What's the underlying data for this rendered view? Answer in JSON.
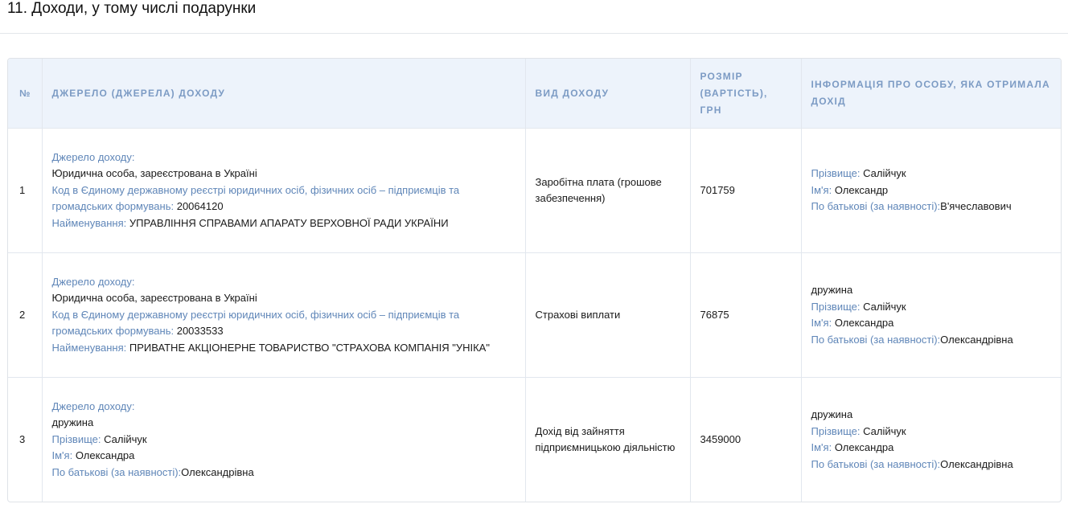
{
  "section": {
    "title": "11. Доходи, у тому числі подарунки"
  },
  "table": {
    "headers": {
      "number": "№",
      "source": "Джерело (джерела) доходу",
      "type": "Вид доходу",
      "amount": "Розмір (вартість), грн",
      "person": "Інформація про особу, яка отримала дохід"
    },
    "rows": [
      {
        "number": "1",
        "source_label": "Джерело доходу:",
        "source_kind": "Юридична особа, зареєстрована в Україні",
        "code_label": "Код в Єдиному державному реєстрі юридичних осіб, фізичних осіб – підприємців та громадських формувань:",
        "code_value": "20064120",
        "name_label": "Найменування:",
        "name_value": "УПРАВЛІННЯ СПРАВАМИ АПАРАТУ ВЕРХОВНОЇ РАДИ УКРАЇНИ",
        "income_type": "Заробітна плата (грошове забезпечення)",
        "amount": "701759",
        "person": {
          "surname_label": "Прізвище:",
          "surname": "Салійчук",
          "name_label": "Ім'я:",
          "name": "Олександр",
          "patronymic_label": "По батькові (за наявності):",
          "patronymic": "В'ячеславович"
        }
      },
      {
        "number": "2",
        "source_label": "Джерело доходу:",
        "source_kind": "Юридична особа, зареєстрована в Україні",
        "code_label": "Код в Єдиному державному реєстрі юридичних осіб, фізичних осіб – підприємців та громадських формувань:",
        "code_value": "20033533",
        "name_label": "Найменування:",
        "name_value": "ПРИВАТНЕ АКЦІОНЕРНЕ ТОВАРИСТВО \"СТРАХОВА КОМПАНІЯ \"УНІКА\"",
        "income_type": "Страхові виплати",
        "amount": "76875",
        "person": {
          "relation": "дружина",
          "surname_label": "Прізвище:",
          "surname": "Салійчук",
          "name_label": "Ім'я:",
          "name": "Олександра",
          "patronymic_label": "По батькові (за наявності):",
          "patronymic": "Олександрівна"
        }
      },
      {
        "number": "3",
        "source_label": "Джерело доходу:",
        "source_relation": "дружина",
        "surname_label": "Прізвище:",
        "surname": "Салійчук",
        "name_label": "Ім'я:",
        "name": "Олександра",
        "patronymic_label": "По батькові (за наявності):",
        "patronymic": "Олександрівна",
        "income_type": "Дохід від зайняття підприємницькою діяльністю",
        "amount": "3459000",
        "person": {
          "relation": "дружина",
          "surname_label": "Прізвище:",
          "surname": "Салійчук",
          "name_label": "Ім'я:",
          "name": "Олександра",
          "patronymic_label": "По батькові (за наявності):",
          "patronymic": "Олександрівна"
        }
      }
    ]
  },
  "colors": {
    "label": "#5f86b8",
    "header_bg": "#edf3fb",
    "header_text": "#7c9bc4"
  }
}
